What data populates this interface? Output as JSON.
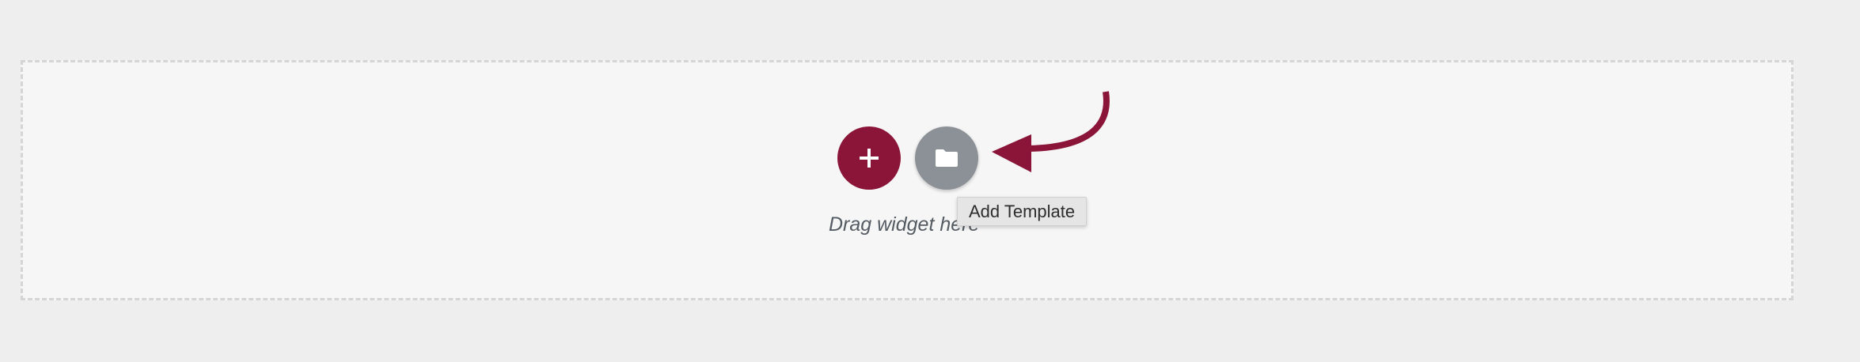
{
  "drop_area": {
    "hint_text": "Drag widget here"
  },
  "buttons": {
    "add_widget_icon": "plus-icon",
    "add_template_icon": "folder-icon"
  },
  "tooltip": {
    "label": "Add Template"
  },
  "colors": {
    "accent": "#8a1538",
    "template_button": "#8b9196",
    "background": "#eeeeee",
    "drop_area_background": "#f6f6f6",
    "hint_text": "#545b62"
  }
}
